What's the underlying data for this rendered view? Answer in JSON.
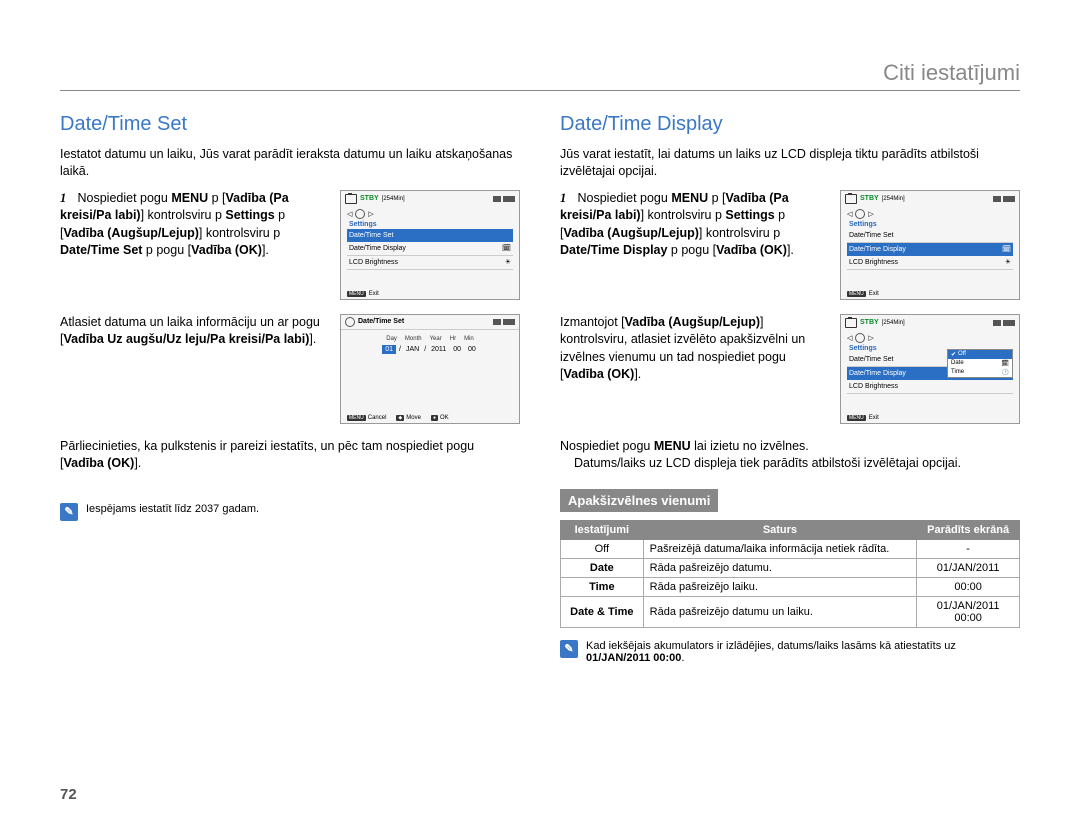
{
  "page_title": "Citi iestatījumi",
  "page_number": "72",
  "left": {
    "heading": "Date/Time Set",
    "intro": "Iestatot datumu un laiku, Jūs varat parādīt ieraksta datumu un laiku atskaņošanas laikā.",
    "step1_num": "1",
    "step1_a": "Nospiediet pogu ",
    "step1_menu": "MENU",
    "step1_b": " p [",
    "step1_vad1": "Vadība (Pa kreisi/Pa labi)",
    "step1_c": "] kontrolsviru p ",
    "step1_settings": "Settings",
    "step1_d": " p [",
    "step1_vad2": "Vadība (Augšup/Lejup)",
    "step1_e": "] kontrolsviru p ",
    "step1_opt": "Date/Time Set",
    "step1_f": " p pogu [",
    "step1_ok": "Vadība (OK)",
    "step1_g": "].",
    "step2_a": "Atlasiet datuma un laika informāciju un ar pogu [",
    "step2_bold": "Vadība Uz augšu/Uz leju/Pa kreisi/Pa labi)",
    "step2_b": "].",
    "step3_a": "Pārliecinieties, ka pulkstenis ir pareizi iestatīts, un pēc tam nospiediet pogu [",
    "step3_bold": "Vadība (OK)",
    "step3_b": "].",
    "note": "Iespējams iestatīt līdz 2037 gadam.",
    "lcd1": {
      "stby": "STBY",
      "time": "[254Min]",
      "cat": "Settings",
      "items": [
        "Date/Time Set",
        "Date/Time Display",
        "LCD Brightness"
      ],
      "exit_tag": "MENU",
      "exit": "Exit"
    },
    "lcd2": {
      "title": "Date/Time Set",
      "labels": [
        "Day",
        "Month",
        "Year",
        "Hr",
        "Min"
      ],
      "vals": [
        "01",
        "JAN",
        "2011",
        "00",
        "00"
      ],
      "cancel_tag": "MENU",
      "cancel": "Cancel",
      "move_tag": "◆",
      "move": "Move",
      "ok_tag": "●",
      "ok": "OK"
    }
  },
  "right": {
    "heading": "Date/Time Display",
    "intro": "Jūs varat iestatīt, lai datums un laiks uz LCD displeja tiktu parādīts atbilstoši izvēlētajai opcijai.",
    "step1_num": "1",
    "step1_a": "Nospiediet pogu ",
    "step1_menu": "MENU",
    "step1_b": " p [",
    "step1_vad1": "Vadība (Pa kreisi/Pa labi)",
    "step1_c": "] kontrolsviru p ",
    "step1_settings": "Settings",
    "step1_d": " p [",
    "step1_vad2": "Vadība (Augšup/Lejup)",
    "step1_e": "] kontrolsviru p ",
    "step1_opt": "Date/Time Display",
    "step1_f": " p pogu [",
    "step1_ok": "Vadība (OK)",
    "step1_g": "].",
    "step2_a": "Izmantojot [",
    "step2_bold1": "Vadība (Augšup/Lejup)",
    "step2_b": "] kontrolsviru, atlasiet izvēlēto apakšizvēlni un izvēlnes vienumu un tad nospiediet pogu [",
    "step2_bold2": "Vadība (OK)",
    "step2_c": "].",
    "step3_a": "Nospiediet pogu ",
    "step3_bold1": "MENU",
    "step3_b": " lai izietu no izvēlnes.",
    "step3_extra": "Datums/laiks uz LCD displeja tiek parādīts atbilstoši izvēlētajai opcijai.",
    "sub_heading": "Apakšizvēlnes vienumi",
    "lcd1": {
      "stby": "STBY",
      "time": "[254Min]",
      "cat": "Settings",
      "items": [
        "Date/Time Set",
        "Date/Time Display",
        "LCD Brightness"
      ],
      "exit_tag": "MENU",
      "exit": "Exit"
    },
    "lcd2": {
      "stby": "STBY",
      "time": "[254Min]",
      "cat": "Settings",
      "items": [
        "Date/Time Set",
        "Date/Time Display",
        "LCD Brightness"
      ],
      "popup": [
        "Off",
        "Date",
        "Time"
      ],
      "exit_tag": "MENU",
      "exit": "Exit"
    },
    "table": {
      "h1": "Iestatījumi",
      "h2": "Saturs",
      "h3": "Parādīts ekrānā",
      "r1c1": "Off",
      "r1c2": "Pašreizējā datuma/laika informācija netiek rādīta.",
      "r1c3": "-",
      "r2c1": "Date",
      "r2c2": "Rāda pašreizējo datumu.",
      "r2c3": "01/JAN/2011",
      "r3c1": "Time",
      "r3c2": "Rāda pašreizējo laiku.",
      "r3c3": "00:00",
      "r4c1": "Date & Time",
      "r4c2": "Rāda pašreizējo datumu un laiku.",
      "r4c3a": "01/JAN/2011",
      "r4c3b": "00:00"
    },
    "note_a": "Kad iekšējais akumulators ir izlādējies, datums/laiks lasāms kā atiestatīts uz ",
    "note_bold": "01/JAN/2011 00:00",
    "note_b": "."
  }
}
